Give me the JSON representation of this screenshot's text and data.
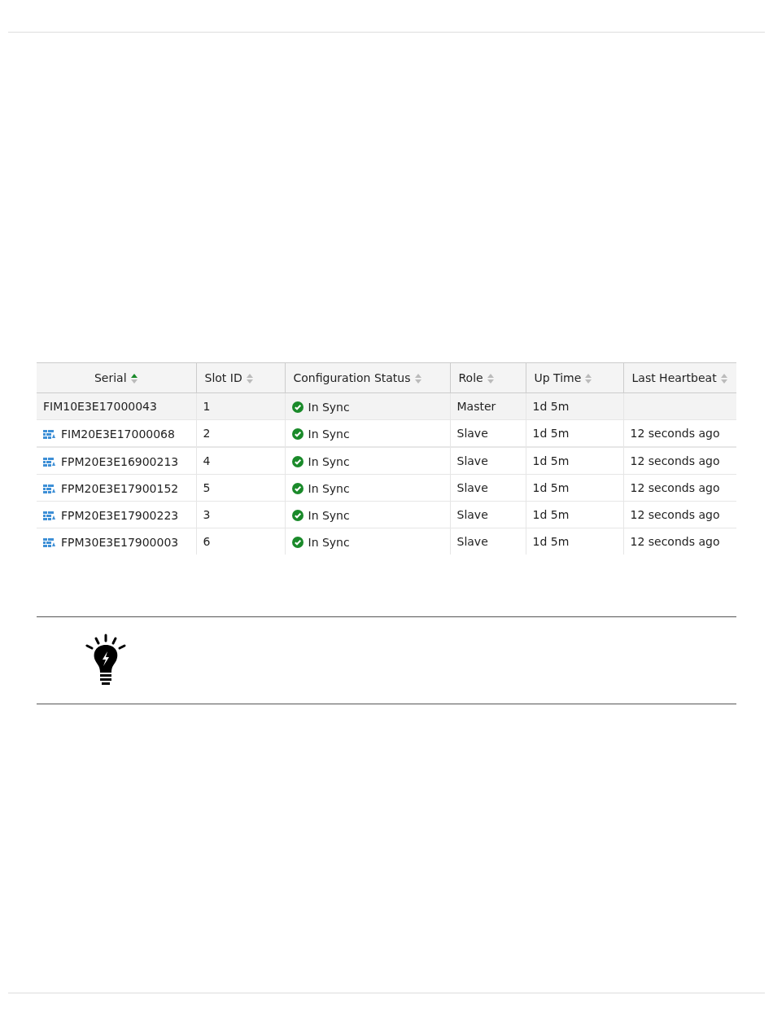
{
  "table": {
    "columns": [
      {
        "label": "Serial",
        "sorted": true
      },
      {
        "label": "Slot ID",
        "sorted": false
      },
      {
        "label": "Configuration Status",
        "sorted": false
      },
      {
        "label": "Role",
        "sorted": false
      },
      {
        "label": "Up Time",
        "sorted": false
      },
      {
        "label": "Last Heartbeat",
        "sorted": false
      }
    ],
    "rows": [
      {
        "kind": "master",
        "selected": true,
        "serial": "FIM10E3E17000043",
        "slot_id": "1",
        "status": "In Sync",
        "role": "Master",
        "up_time": "1d 5m"
      },
      {
        "kind": "member",
        "selected": false,
        "serial": "FIM20E3E17000068",
        "slot_id": "2",
        "status": "In Sync",
        "role": "Slave",
        "up_time": "1d 5m",
        "last_heartbeat": "12 seconds ago"
      },
      {
        "kind": "member",
        "selected": false,
        "serial": "FPM20E3E16900213",
        "slot_id": "4",
        "status": "In Sync",
        "role": "Slave",
        "up_time": "1d 5m",
        "last_heartbeat": "12 seconds ago"
      },
      {
        "kind": "member",
        "selected": false,
        "serial": "FPM20E3E17900152",
        "slot_id": "5",
        "status": "In Sync",
        "role": "Slave",
        "up_time": "1d 5m",
        "last_heartbeat": "12 seconds ago"
      },
      {
        "kind": "member",
        "selected": false,
        "serial": "FPM20E3E17900223",
        "slot_id": "3",
        "status": "In Sync",
        "role": "Slave",
        "up_time": "1d 5m",
        "last_heartbeat": "12 seconds ago"
      },
      {
        "kind": "member",
        "selected": false,
        "serial": "FPM30E3E17900003",
        "slot_id": "6",
        "status": "In Sync",
        "role": "Slave",
        "up_time": "1d 5m",
        "last_heartbeat": "12 seconds ago"
      }
    ]
  }
}
